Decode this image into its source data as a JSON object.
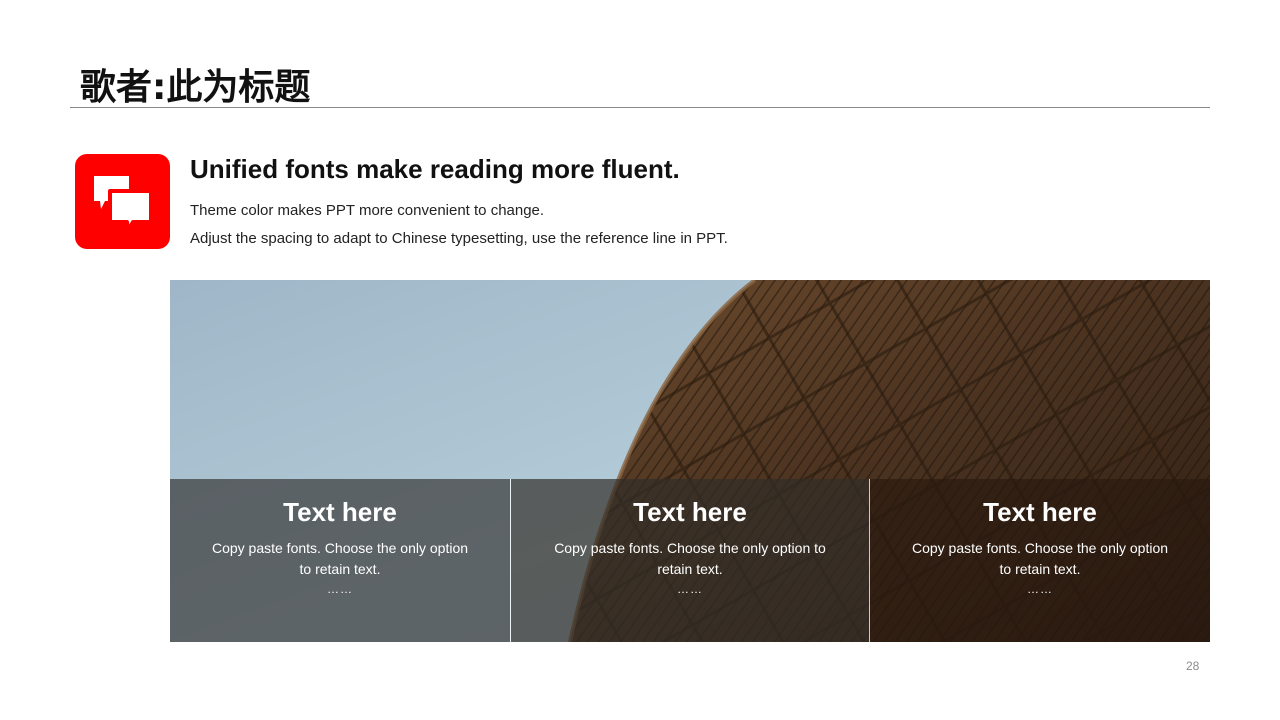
{
  "slide": {
    "title": "歌者:此为标题",
    "page_number": "28",
    "icon": "chat-bubbles-icon",
    "accent_color": "#ff0000"
  },
  "intro": {
    "headline": "Unified fonts make reading more fluent.",
    "line1": "Theme color makes PPT more convenient to change.",
    "line2": "Adjust the spacing to adapt to Chinese typesetting, use the reference line in PPT."
  },
  "panels": [
    {
      "title": "Text here",
      "body": "Copy paste fonts. Choose the only option to retain text.",
      "ellipsis": "……"
    },
    {
      "title": "Text here",
      "body": "Copy paste fonts. Choose the only option to retain text.",
      "ellipsis": "……"
    },
    {
      "title": "Text here",
      "body": "Copy paste fonts. Choose the only option to retain text.",
      "ellipsis": "……"
    }
  ]
}
